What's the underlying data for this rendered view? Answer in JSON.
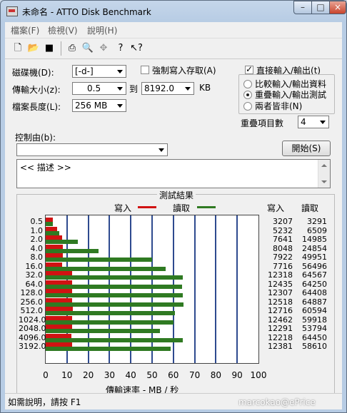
{
  "window": {
    "title": "未命名 - ATTO Disk Benchmark",
    "min": "–",
    "max": "□",
    "close": "×"
  },
  "menu": [
    "檔案(F)",
    "檢視(V)",
    "說明(H)"
  ],
  "toolbar": {
    "icons": [
      "new-file-icon",
      "open-folder-icon",
      "save-disk-icon",
      "print-icon",
      "print-preview-icon",
      "move-cross-icon",
      "help-icon",
      "context-help-icon"
    ]
  },
  "form": {
    "drive_label": "磁碟機(D):",
    "drive_value": "[-d-]",
    "force_write_label": "強制寫入存取(A)",
    "force_write_checked": false,
    "transfer_label": "傳輸大小(z):",
    "transfer_from": "0.5",
    "to_label": "到",
    "transfer_to": "8192.0",
    "kb_label": "KB",
    "file_length_label": "檔案長度(L):",
    "file_length_value": "256 MB",
    "direct_io_label": "直接輸入/輸出(t)",
    "direct_io_checked": true,
    "radio_options": [
      "比較輸入/輸出資料",
      "重疊輸入/輸出測試",
      "兩者皆非(N)"
    ],
    "radio_selected": 1,
    "queue_label": "重疊項目數",
    "queue_value": "4",
    "control_label": "控制由(b):",
    "control_value": "",
    "start_button": "開始(S)",
    "description_text": "<<    描述    >>"
  },
  "results": {
    "title": "測試結果",
    "legend_write": "寫入",
    "legend_read": "讀取",
    "col_write": "寫入",
    "col_read": "讀取",
    "xlabel": "傳輸速率 - MB / 秒"
  },
  "chart_data": {
    "type": "bar",
    "orientation": "horizontal",
    "categories": [
      "0.5",
      "1.0",
      "2.0",
      "4.0",
      "8.0",
      "16.0",
      "32.0",
      "64.0",
      "128.0",
      "256.0",
      "512.0",
      "1024.0",
      "2048.0",
      "4096.0",
      "3192.0"
    ],
    "series": [
      {
        "name": "寫入",
        "color": "#d01212",
        "values": [
          3207,
          5232,
          7641,
          8048,
          7922,
          7716,
          12318,
          12435,
          12307,
          12518,
          12716,
          12462,
          12291,
          12218,
          12381
        ]
      },
      {
        "name": "讀取",
        "color": "#2f7a22",
        "values": [
          3291,
          6509,
          14985,
          24854,
          49951,
          56496,
          64567,
          64250,
          64408,
          64887,
          60594,
          59918,
          53794,
          64450,
          58610
        ]
      }
    ],
    "bar_scale_divisor": 1000,
    "xlim": [
      0,
      100
    ],
    "xticks": [
      "0",
      "10",
      "20",
      "30",
      "40",
      "50",
      "60",
      "70",
      "80",
      "90",
      "100"
    ],
    "xlabel": "傳輸速率 - MB / 秒",
    "grid": true
  },
  "status": {
    "help_text": "如需說明，請按 F1"
  },
  "watermark": "marcokao@ePrice"
}
